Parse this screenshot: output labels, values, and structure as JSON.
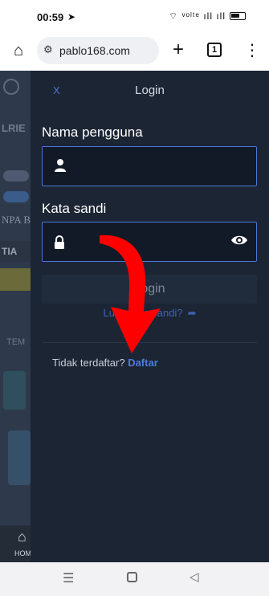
{
  "status_bar": {
    "time": "00:59",
    "arrow": "➤",
    "signal": "⌔ ᵛᵒˡᵗᵉ ıll ıll"
  },
  "browser": {
    "home_icon": "⌂",
    "url": "pablo168.com",
    "site_settings_icon": "⚙",
    "new_tab_icon": "+",
    "tab_count": "1",
    "menu_icon": "⋮"
  },
  "background_page": {
    "logo_text": "LRIE",
    "text1": "NPA BI",
    "text2": "TIA",
    "text3": "TEM",
    "nav_home_icon": "⌂",
    "nav_home_label": "HOME"
  },
  "login_panel": {
    "close_label": "X",
    "title": "Login",
    "username_label": "Nama pengguna",
    "username_value": "",
    "password_label": "Kata sandi",
    "password_value": "",
    "login_button": "Login",
    "forgot_password": "Lupa kata sandi?",
    "not_registered": "Tidak terdaftar?",
    "register_link": "Daftar",
    "icons": [
      "user-icon",
      "lock-icon",
      "eye-icon",
      "share-arrow-icon"
    ]
  },
  "system_nav": {
    "recents_icon": "☰",
    "back_icon": "◁"
  },
  "colors": {
    "panel_bg": "#1c2534",
    "input_border": "#4a78d6",
    "link": "#4c7be0",
    "annotation_arrow": "#ff0000"
  }
}
